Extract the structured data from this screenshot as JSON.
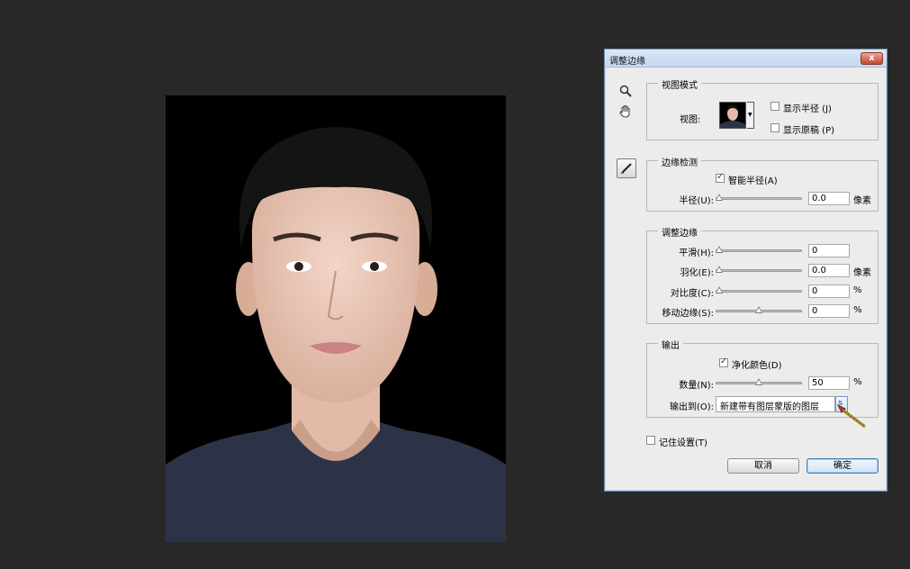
{
  "dialog": {
    "title": "调整边缘",
    "close_label": "x"
  },
  "view_mode": {
    "legend": "视图模式",
    "view_label": "视图:",
    "show_radius": "显示半径 (J)",
    "show_original": "显示原稿 (P)"
  },
  "edge_detection": {
    "legend": "边缘检测",
    "smart_radius": "智能半径(A)",
    "radius_label": "半径(U):",
    "radius_value": "0.0",
    "radius_unit": "像素",
    "radius_level": 0
  },
  "adjust_edge": {
    "legend": "调整边缘",
    "smooth_label": "平滑(H):",
    "smooth_value": "0",
    "smooth_level": 0,
    "feather_label": "羽化(E):",
    "feather_value": "0.0",
    "feather_unit": "像素",
    "feather_level": 0,
    "contrast_label": "对比度(C):",
    "contrast_value": "0",
    "contrast_unit": "%",
    "contrast_level": 0,
    "shift_label": "移动边缘(S):",
    "shift_value": "0",
    "shift_unit": "%",
    "shift_level": 0.5
  },
  "output": {
    "legend": "输出",
    "decontaminate": "净化颜色(D)",
    "amount_label": "数量(N):",
    "amount_value": "50",
    "amount_unit": "%",
    "amount_level": 0.5,
    "output_to_label": "输出到(O):",
    "output_to_value": "新建带有图层蒙版的图层"
  },
  "remember": "记住设置(T)",
  "buttons": {
    "cancel": "取消",
    "ok": "确定"
  },
  "colors": {
    "app_background": "#282828",
    "dialog_background": "#ececec",
    "shirt": "#2d3347"
  }
}
